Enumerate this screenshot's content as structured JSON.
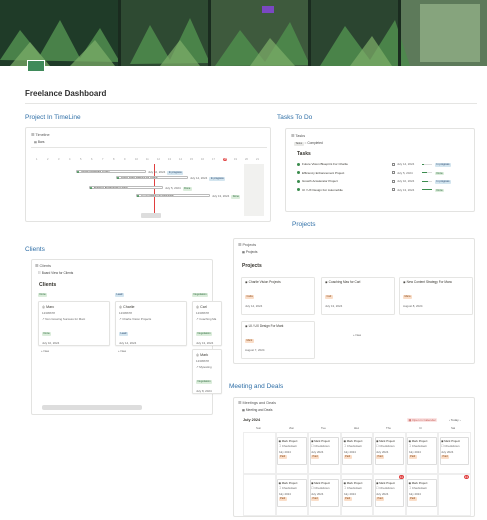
{
  "page": {
    "title": "Freelance Dashboard",
    "sections": {
      "timeline_heading": "Project In TimeLine",
      "tasks_heading": "Tasks To Do",
      "clients_heading": "Clients",
      "projects_heading": "Projects",
      "meetings_heading": "Meeting and Deals"
    }
  },
  "timeline_db": {
    "title": "Timeline",
    "view": "Bars",
    "ticks": [
      "1",
      "2",
      "3",
      "4",
      "5",
      "6",
      "7",
      "8",
      "9",
      "10",
      "11",
      "12",
      "13",
      "14",
      "15",
      "16",
      "17",
      "18",
      "19",
      "20",
      "21"
    ],
    "today": "18",
    "bars": [
      {
        "name": "Growth Accelerator Project",
        "dates": "July 10, 2024",
        "status": "In progress"
      },
      {
        "name": "Future Vision Blueprint For Charlie",
        "dates": "July 14, 2024",
        "status": "In progress"
      },
      {
        "name": "Efficiency Enhancement Project",
        "dates": "July 5, 2024",
        "status": "Done"
      },
      {
        "name": "UI / UX Design For Automobile",
        "dates": "July 13, 2024",
        "status": "Done"
      }
    ]
  },
  "tasks_db": {
    "title": "Tasks",
    "views": [
      "Tasks",
      "Completed"
    ],
    "heading": "Tasks",
    "rows": [
      {
        "name": "Future Vision Blueprint For Charlie",
        "date": "July 14, 2024",
        "progress": 0.2,
        "status": "In progress"
      },
      {
        "name": "Efficiency Enhancement Project",
        "date": "July 5, 2024",
        "progress": 0.5,
        "status": "Done"
      },
      {
        "name": "Growth Accelerator Project",
        "date": "July 10, 2024",
        "progress": 0.6,
        "status": "In progress"
      },
      {
        "name": "UI / UX Design For Automobile",
        "date": "July 13, 2024",
        "progress": 1.0,
        "status": "Done"
      }
    ]
  },
  "clients_db": {
    "title": "Clients",
    "view": "Board View for Clients",
    "heading": "Clients",
    "columns": [
      {
        "label": "Done",
        "cards": [
          {
            "name": "Marc",
            "phone": "12345678",
            "project": "Non Growing Success for Marc",
            "tag": "Done",
            "date": "July 10, 2024"
          }
        ]
      },
      {
        "label": "Lead",
        "cards": [
          {
            "name": "Charlie",
            "phone": "12345678",
            "project": "Charlie Vision Projects",
            "tag": "Lead",
            "date": "July 14, 2024"
          }
        ]
      },
      {
        "label": "Negotiation",
        "cards": [
          {
            "name": "Carl",
            "phone": "12345678",
            "project": "Coaching Ma",
            "tag": "Negotiation",
            "date": "July 13, 2024"
          },
          {
            "name": "Mark",
            "phone": "12345678",
            "project": "Mytesting",
            "tag": "Negotiation",
            "date": "July 8, 2024"
          }
        ]
      }
    ],
    "new_label": "+ New"
  },
  "projects_db": {
    "title": "Projects",
    "view": "Projects",
    "heading": "Projects",
    "cards": [
      {
        "name": "Charlie Vision Projects",
        "client": "Carla",
        "date": "July 14, 2024",
        "status": "Not started"
      },
      {
        "name": "Coaching Mas for Carl",
        "client": "Carl",
        "date": "July 13, 2024",
        "status": "In progress"
      },
      {
        "name": "New Content Strategy For Mara",
        "client": "Mara",
        "date": "August 8, 2024",
        "status": "Not started"
      },
      {
        "name": "UI / UX Design For Mark",
        "client": "Mark",
        "date": "August 7, 2024",
        "status": "Not started"
      }
    ],
    "new_label": "+ New"
  },
  "meetings_db": {
    "title": "Meetings and Deals",
    "view": "Meeting and Deals",
    "month": "July 2024",
    "open_calendar": "Open in Calendar",
    "today_label": "Today",
    "weekdays": [
      "Sun",
      "Mon",
      "Tue",
      "Wed",
      "Thu",
      "Fri",
      "Sat"
    ],
    "event_title": "Mark Project",
    "event_sub": "Checkdown",
    "event_tag": "Paid",
    "day_numbers": [
      "",
      "",
      "",
      "",
      "",
      "",
      "",
      "",
      "",
      "",
      "",
      "11",
      "",
      "13"
    ]
  }
}
